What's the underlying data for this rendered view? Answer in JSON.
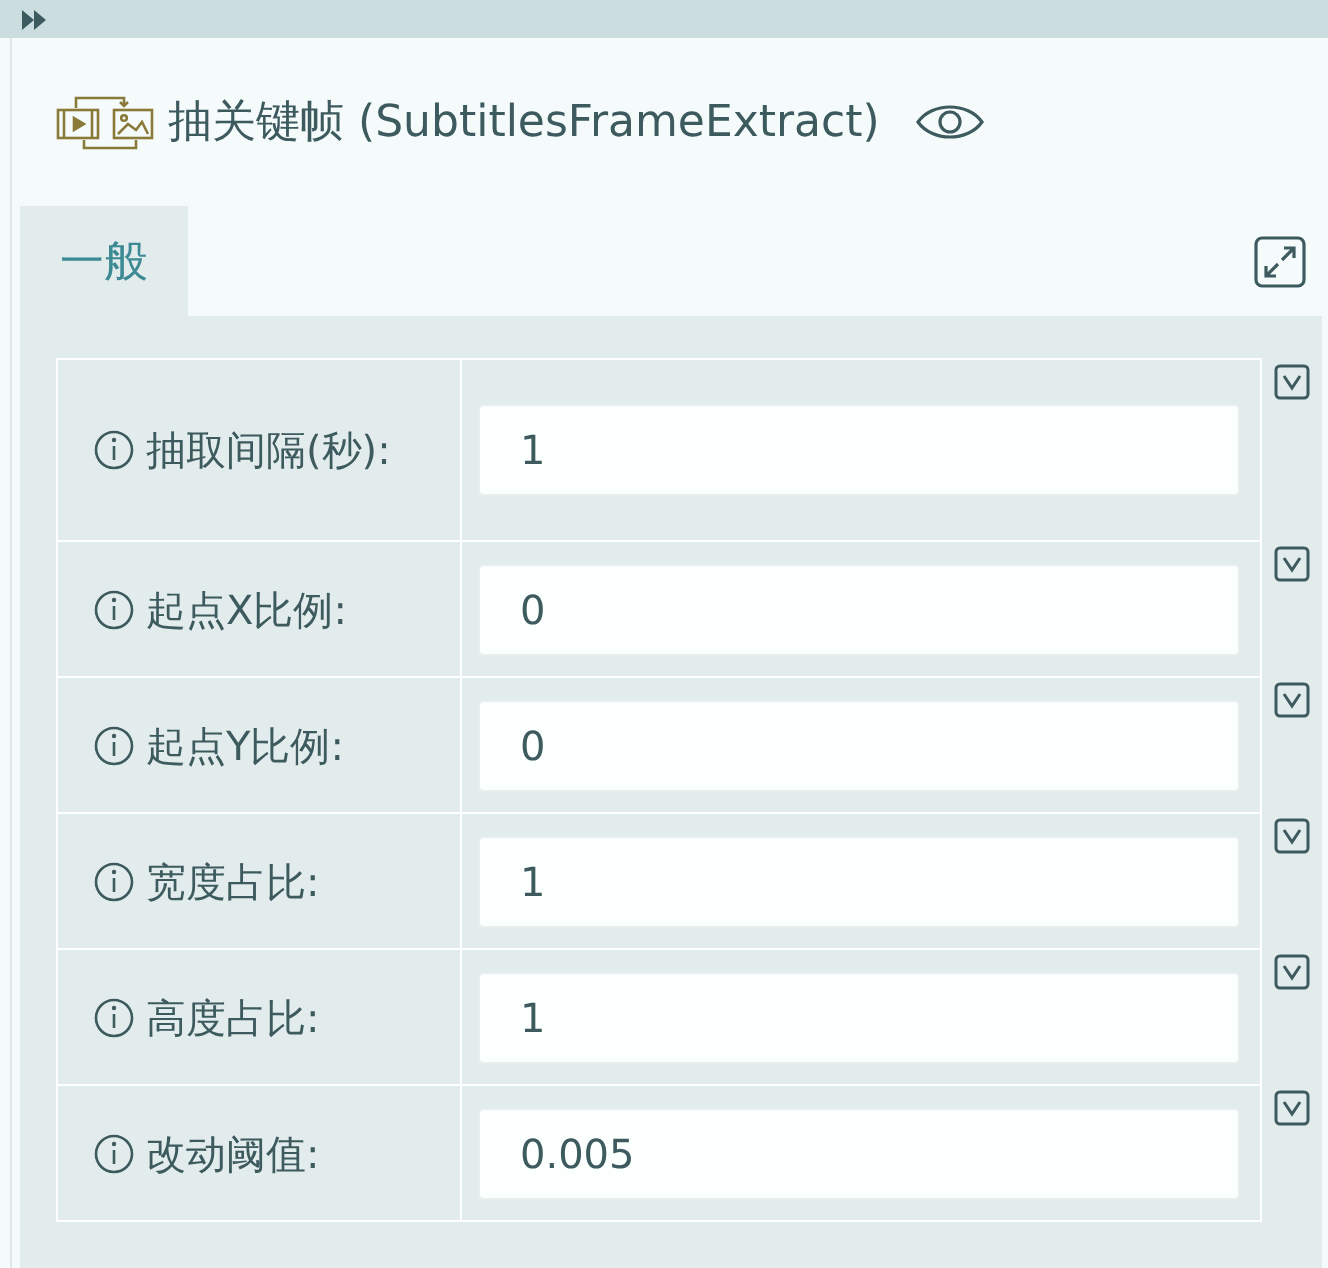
{
  "title": "抽关键帧 (SubtitlesFrameExtract)",
  "tabs": [
    {
      "label": "一般",
      "selected": true
    }
  ],
  "fields": [
    {
      "label": "抽取间隔(秒):",
      "value": "1"
    },
    {
      "label": "起点X比例:",
      "value": "0"
    },
    {
      "label": "起点Y比例:",
      "value": "0"
    },
    {
      "label": "宽度占比:",
      "value": "1"
    },
    {
      "label": "高度占比:",
      "value": "1"
    },
    {
      "label": "改动阈值:",
      "value": "0.005"
    }
  ]
}
